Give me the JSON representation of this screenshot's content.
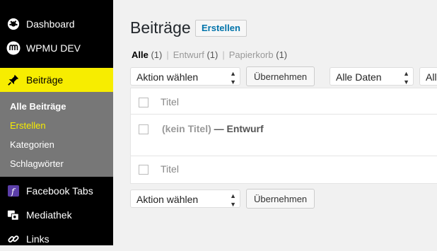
{
  "sidebar": {
    "dashboard": {
      "label": "Dashboard",
      "icon": "dashboard-icon"
    },
    "wpmu": {
      "label": "WPMU DEV",
      "icon": "wpmu-logo-icon"
    },
    "posts": {
      "label": "Beiträge",
      "icon": "pin-icon"
    },
    "submenu": [
      "Alle Beiträge",
      "Erstellen",
      "Kategorien",
      "Schlagwörter"
    ],
    "facebook": {
      "label": "Facebook Tabs",
      "icon": "facebook-icon"
    },
    "media": {
      "label": "Mediathek",
      "icon": "media-icon"
    },
    "links": {
      "label": "Links",
      "icon": "link-icon"
    }
  },
  "header": {
    "title": "Beiträge",
    "add_new": "Erstellen"
  },
  "views": [
    {
      "label": "Alle",
      "count": "(1)"
    },
    {
      "label": "Entwurf",
      "count": "(1)"
    },
    {
      "label": "Papierkorb",
      "count": "(1)"
    }
  ],
  "filters": {
    "bulk_action": "Aktion wählen",
    "apply": "Übernehmen",
    "dates": "Alle Daten",
    "categories": "All"
  },
  "table": {
    "column_title": "Titel",
    "rows": [
      {
        "title": "(kein Titel)",
        "state": "— Entwurf"
      }
    ]
  },
  "colors": {
    "accent": "#f7ed00",
    "sidebar": "#000000",
    "submenu": "#777777",
    "link": "#0073aa"
  }
}
